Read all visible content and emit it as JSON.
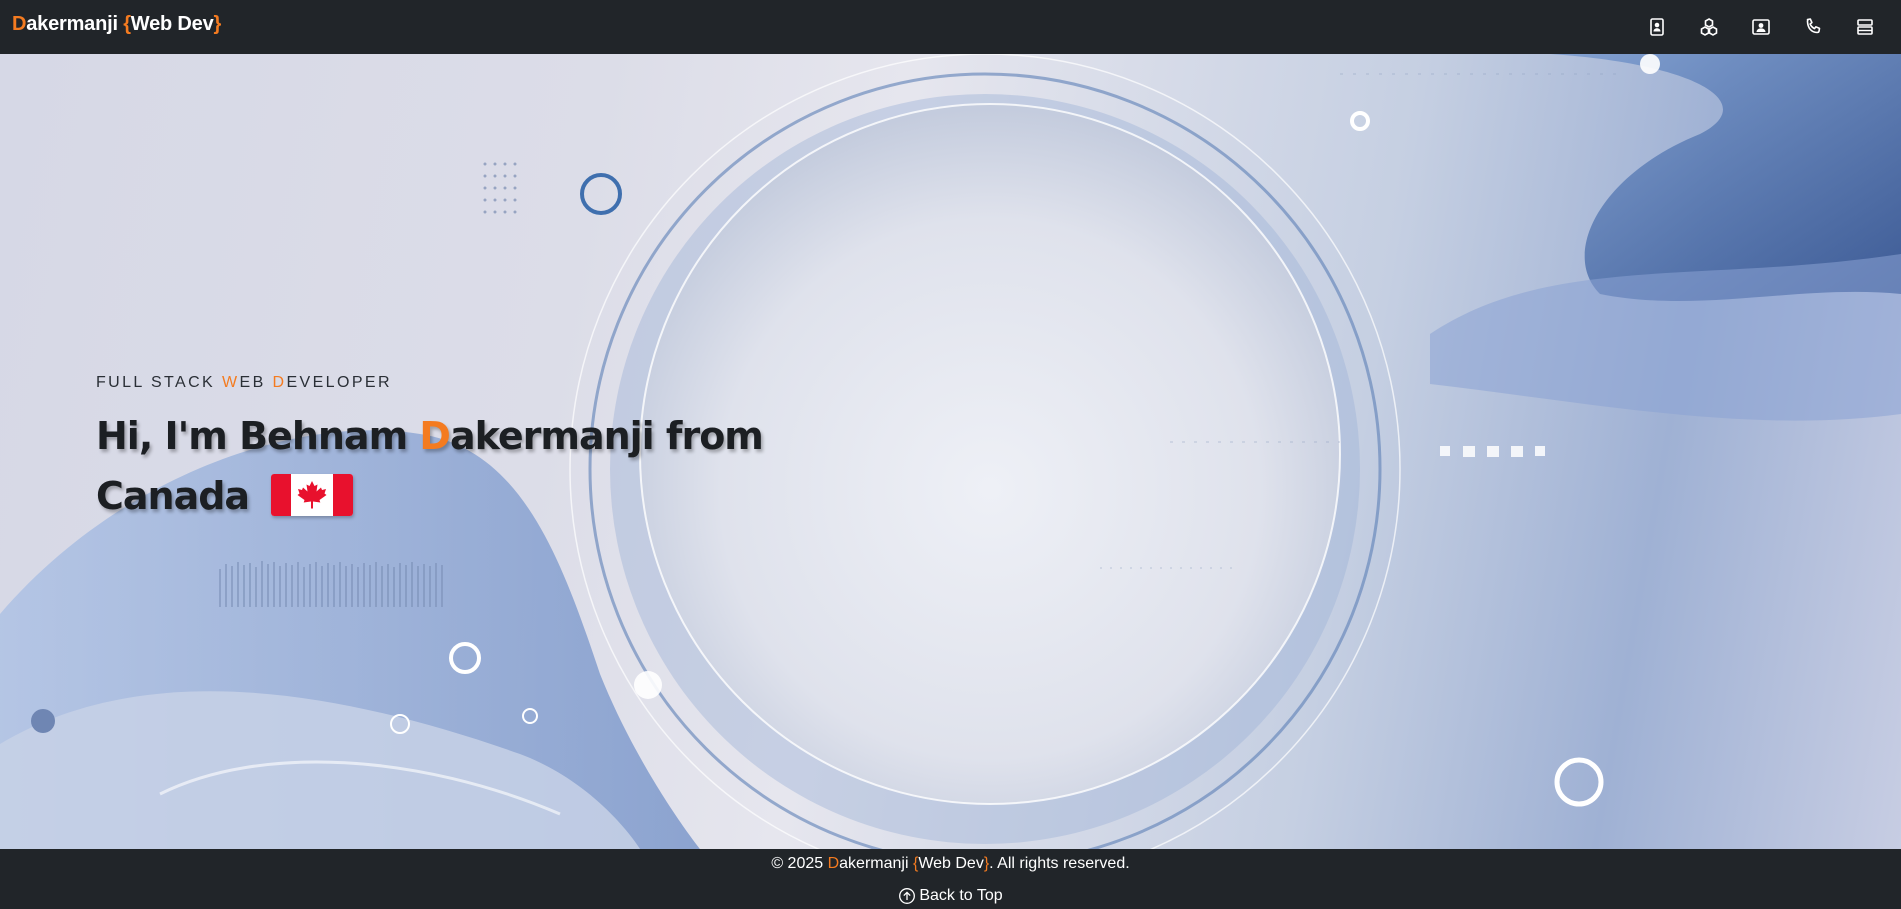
{
  "brand": {
    "first_letter": "D",
    "rest": "akermanji",
    "open_brace": "{",
    "middle": "Web Dev",
    "close_brace": "}"
  },
  "nav": {
    "icons": [
      "contact-card-icon",
      "skills-icon",
      "portfolio-icon",
      "phone-icon",
      "menu-icon"
    ]
  },
  "hero": {
    "subtitle_part1": "FULL STACK ",
    "subtitle_acc1": "W",
    "subtitle_part2": "EB ",
    "subtitle_acc2": "D",
    "subtitle_part3": "EVELOPER",
    "headline_part1": "Hi, I'm Behnam ",
    "headline_acc": "D",
    "headline_part2": "akermanji from",
    "headline_line2": "Canada",
    "flag_icon": "canada-flag-icon"
  },
  "footer": {
    "copyright_prefix": "© 2025 ",
    "brand_first": "D",
    "brand_rest": "akermanji ",
    "brace_open": "{",
    "brand_middle": "Web Dev",
    "brace_close": "}",
    "copyright_suffix": ". All rights reserved.",
    "back_to_top": "Back to Top"
  },
  "colors": {
    "navbar_bg": "#212529",
    "accent": "#f47b20",
    "text_light": "#ffffff",
    "text_dark": "#1c1f23"
  }
}
